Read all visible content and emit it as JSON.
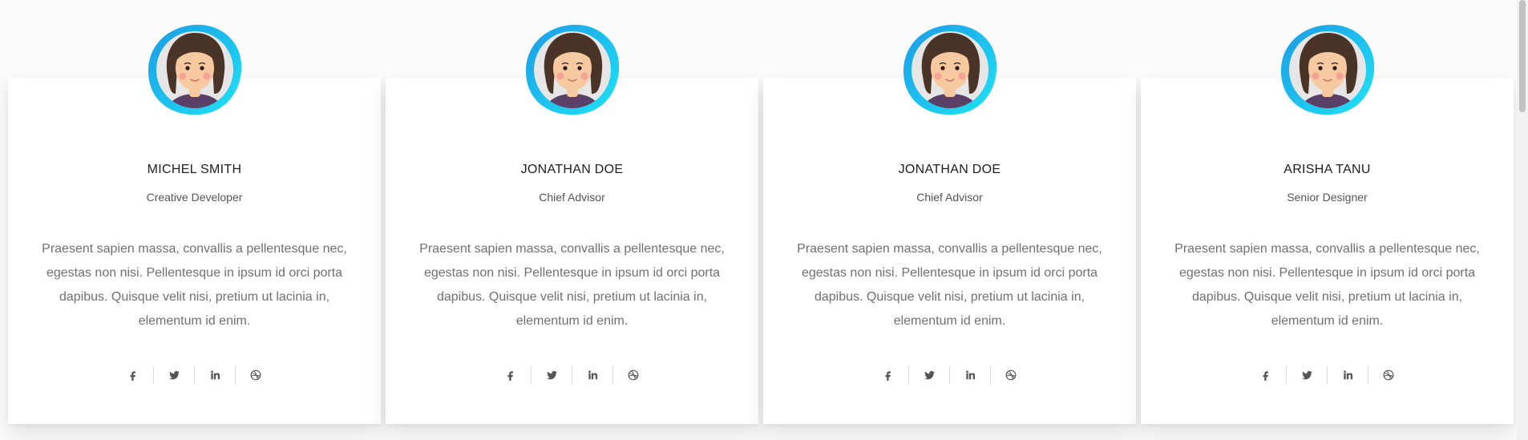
{
  "team": [
    {
      "name": "MICHEL SMITH",
      "role": "Creative Developer",
      "bio": "Praesent sapien massa, convallis a pellentesque nec, egestas non nisi. Pellentesque in ipsum id orci porta dapibus. Quisque velit nisi, pretium ut lacinia in, elementum id enim.",
      "social": [
        "facebook-icon",
        "twitter-icon",
        "linkedin-icon",
        "dribbble-icon"
      ]
    },
    {
      "name": "JONATHAN DOE",
      "role": "Chief Advisor",
      "bio": "Praesent sapien massa, convallis a pellentesque nec, egestas non nisi. Pellentesque in ipsum id orci porta dapibus. Quisque velit nisi, pretium ut lacinia in, elementum id enim.",
      "social": [
        "facebook-icon",
        "twitter-icon",
        "linkedin-icon",
        "dribbble-icon"
      ]
    },
    {
      "name": "JONATHAN DOE",
      "role": "Chief Advisor",
      "bio": "Praesent sapien massa, convallis a pellentesque nec, egestas non nisi. Pellentesque in ipsum id orci porta dapibus. Quisque velit nisi, pretium ut lacinia in, elementum id enim.",
      "social": [
        "facebook-icon",
        "twitter-icon",
        "linkedin-icon",
        "dribbble-icon"
      ]
    },
    {
      "name": "ARISHA TANU",
      "role": "Senior Designer",
      "bio": "Praesent sapien massa, convallis a pellentesque nec, egestas non nisi. Pellentesque in ipsum id orci porta dapibus. Quisque velit nisi, pretium ut lacinia in, elementum id enim.",
      "social": [
        "facebook-icon",
        "twitter-icon",
        "linkedin-icon",
        "dribbble-icon"
      ]
    }
  ],
  "colors": {
    "accent_cyan": "#1ee3f5",
    "accent_blue": "#1c9be6",
    "hair": "#4a3428",
    "skin": "#f7c9a0",
    "shirt": "#5a3f66"
  }
}
